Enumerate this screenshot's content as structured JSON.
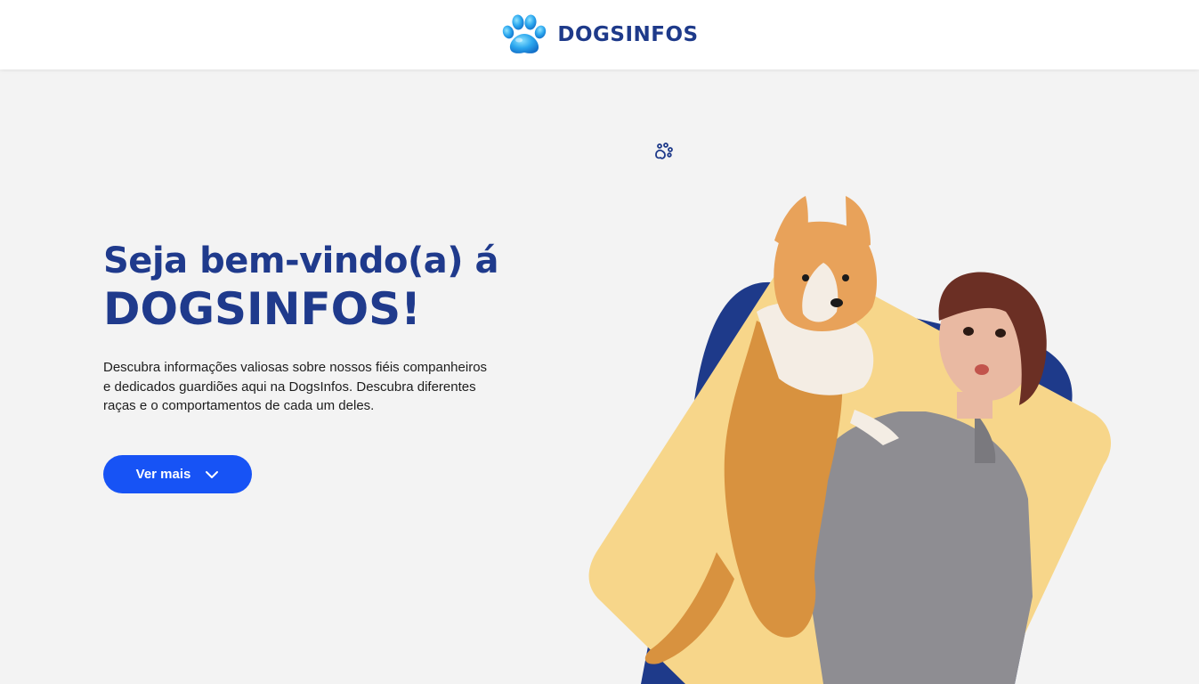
{
  "header": {
    "brand": "DOGSINFOS",
    "logo_icon": "paw-print-icon",
    "brand_color": "#1e3a8a"
  },
  "hero": {
    "title_line1": "Seja bem-vindo(a) á",
    "title_line2": "DOGSINFOS!",
    "description": "Descubra informações valiosas sobre nossos fiéis companheiros e dedicados guardiões aqui na DogsInfos. Descubra diferentes raças e o comportamentos de cada um deles.",
    "cta_label": "Ver mais",
    "cta_icon": "chevron-down-icon",
    "decor_icon": "paw-print-icon",
    "image": "woman-holding-corgi-illustration"
  },
  "colors": {
    "background": "#f3f3f3",
    "title": "#1f3a8c",
    "button": "#1753f5",
    "shape_blue": "#1e3a8a",
    "shape_yellow": "#f7d68a"
  }
}
